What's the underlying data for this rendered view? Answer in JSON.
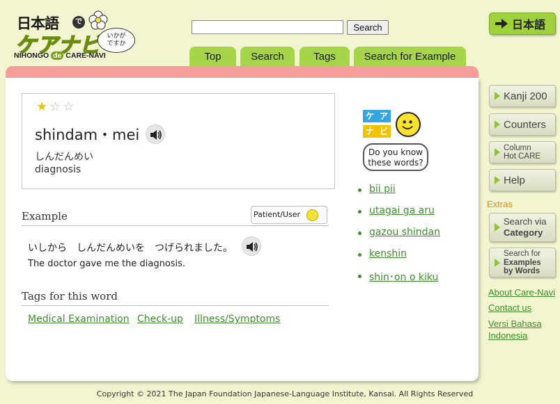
{
  "logo": {
    "line1": "日本語",
    "de": "で",
    "line2": "ケアナビ",
    "bubble_l1": "いかが",
    "bubble_l2": "ですか",
    "sub_pre": "NIHONGO ",
    "sub_de": "de",
    "sub_post": " CARE-NAVI"
  },
  "search": {
    "value": "",
    "button": "Search"
  },
  "language_button": "日本語",
  "tabs": [
    "Top",
    "Search",
    "Tags",
    "Search for Example"
  ],
  "word": {
    "difficulty_stars": 1,
    "max_stars": 3,
    "romaji": "shindam・mei",
    "kana": "しんだんめい",
    "meaning": "diagnosis"
  },
  "example": {
    "title": "Example",
    "badge": "Patient/User",
    "japanese": "いしから　しんだんめいを　つげられました。",
    "english": "The doctor gave me the diagnosis."
  },
  "tags": {
    "title": "Tags for this word",
    "items": [
      "Medical Examination",
      "Check-up",
      "Illness/Symptoms"
    ]
  },
  "care_navi_promo": {
    "b1": "ケ",
    "b2": "ア",
    "b3": "ナ",
    "b4": "ビ",
    "line1": "Do you know",
    "line2": "these words?"
  },
  "related_words": [
    "bii pii",
    "utagai ga aru",
    "gazou shindan",
    "kenshin",
    "shin･on o kiku"
  ],
  "sidebar": {
    "kanji": "Kanji 200",
    "counters": "Counters",
    "column_l1": "Column",
    "column_l2": "Hot CARE",
    "help": "Help",
    "extras": "Extras",
    "sv_l1": "Search via",
    "sv_l2": "Category",
    "se_l1": "Search for",
    "se_l2": "Examples",
    "se_l3": "by Words",
    "about": "About Care-Navi",
    "contact": "Contact us",
    "versi_l1": "Versi Bahasa",
    "versi_l2": "Indonesia"
  },
  "footer": "Copyright © 2021 The Japan Foundation Japanese-Language Institute, Kansai. All Rights Reserved",
  "colors": {
    "accent_green": "#a6d44a",
    "link_green": "#3e8f2c",
    "panel_pink": "#f59e9c",
    "extras_orange": "#f08a00"
  }
}
